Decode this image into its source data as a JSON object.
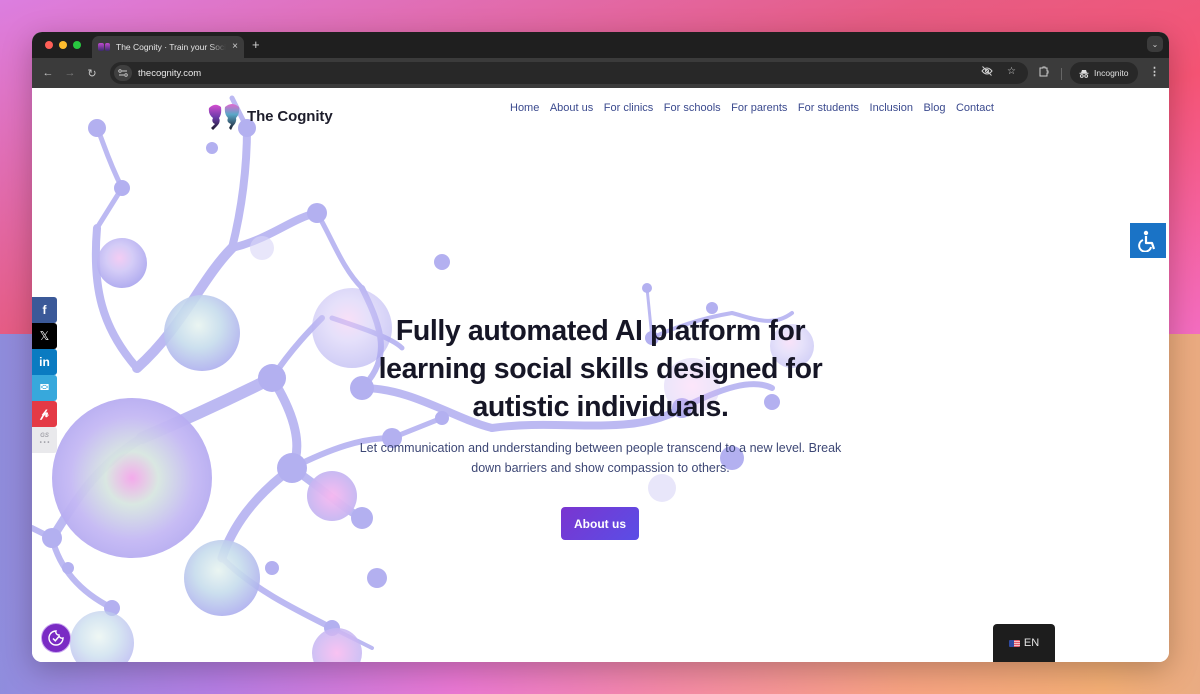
{
  "browser": {
    "tab_title": "The Cognity · Train your Social",
    "tab_close": "×",
    "new_tab": "+",
    "url": "thecognity.com",
    "incognito_label": "Incognito",
    "icons": {
      "back": "←",
      "forward": "→",
      "reload": "↻",
      "site_info": "⚙",
      "eye_off": "👁",
      "star": "☆",
      "extensions": "⧉",
      "incognito": "🕵",
      "menu": "⋮",
      "tab_search": "⌄"
    }
  },
  "site": {
    "logo_text": "The Cognity",
    "nav": [
      "Home",
      "About us",
      "For clinics",
      "For schools",
      "For parents",
      "For students",
      "Inclusion",
      "Blog",
      "Contact"
    ]
  },
  "hero": {
    "title_lines": [
      "Fully automated AI platform for",
      "learning social skills designed for",
      "autistic individuals."
    ],
    "subtitle_lines": [
      "Let communication and understanding between people transcend to a new level. Break",
      "down barriers and show compassion to others."
    ],
    "cta_label": "About us"
  },
  "share_bar": {
    "items": [
      {
        "name": "facebook",
        "glyph": "f"
      },
      {
        "name": "x",
        "glyph": "𝕏"
      },
      {
        "name": "linkedin",
        "glyph": "in"
      },
      {
        "name": "email",
        "glyph": "✉"
      },
      {
        "name": "pinterest",
        "glyph": "𝓅"
      },
      {
        "name": "more",
        "glyph": "GS",
        "sub": "• • •"
      }
    ]
  },
  "language": {
    "label": "EN"
  },
  "colors": {
    "accent": "#7a35d0",
    "nav_link": "#3b4a8e",
    "accessibility": "#1a73c6"
  }
}
